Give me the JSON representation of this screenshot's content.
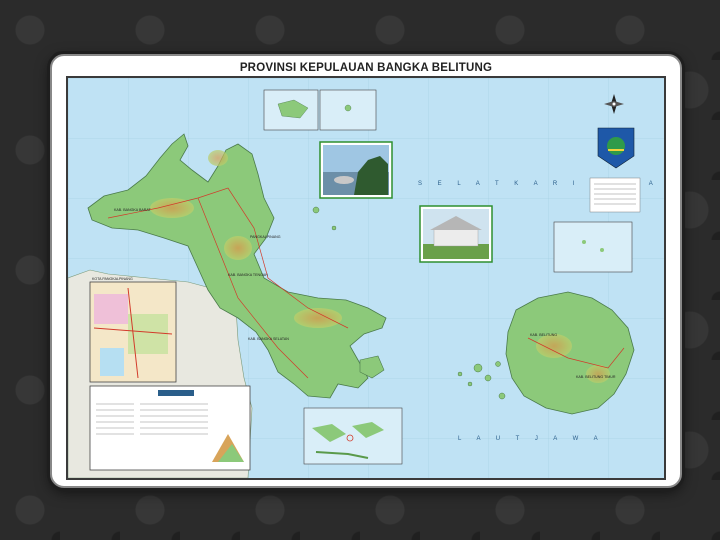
{
  "title": "PROVINSI  KEPULAUAN  BANGKA BELITUNG",
  "sea_labels": {
    "north": "S E L A T   K A R I M A T A",
    "south": "L A U T   J A W A"
  },
  "place_labels": {
    "bangka_barat": "KAB. BANGKA BARAT",
    "bangka_tengah": "KAB. BANGKA TENGAH",
    "bangka_selatan": "KAB. BANGKA SELATAN",
    "pangkalpinang": "PANGKALPINANG",
    "belitung": "KAB. BELITUNG",
    "belitung_timur": "KAB. BELITUNG TIMUR",
    "city_inset": "KOTA PANGKALPINANG"
  },
  "icons": [
    "compass-rose-icon",
    "province-emblem-icon"
  ],
  "colors": {
    "sea": "#bfe2f4",
    "land_lowland": "#8cc97a",
    "land_upland": "#c9d77a",
    "land_high": "#d8a45a",
    "frame": "#ffffff"
  }
}
